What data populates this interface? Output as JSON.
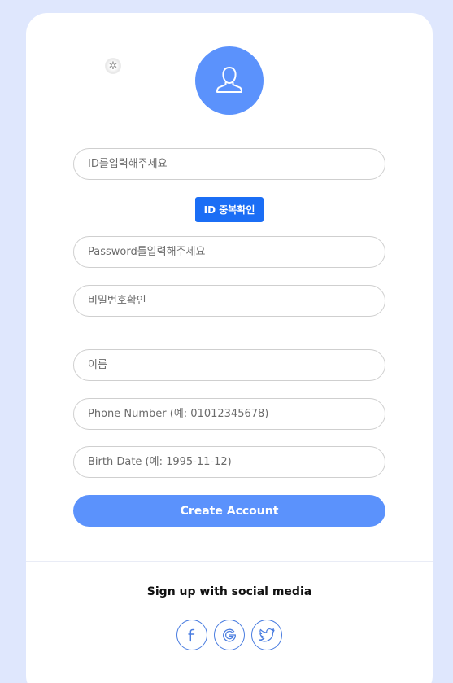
{
  "form": {
    "id_placeholder": "ID를입력해주세요",
    "id_check_label": "ID 중복확인",
    "password_placeholder": "Password를입력해주세요",
    "password_confirm_placeholder": "비밀번호확인",
    "name_placeholder": "이름",
    "phone_placeholder": "Phone Number (예: 01012345678)",
    "birth_placeholder": "Birth Date (예: 1995-11-12)",
    "create_label": "Create Account"
  },
  "social": {
    "title": "Sign up with social media",
    "buttons": [
      {
        "icon": "facebook-icon"
      },
      {
        "icon": "google-icon"
      },
      {
        "icon": "twitter-icon"
      }
    ]
  },
  "colors": {
    "background": "#dfe7fd",
    "accent": "#5b92fc",
    "button": "#1b6ef5"
  }
}
